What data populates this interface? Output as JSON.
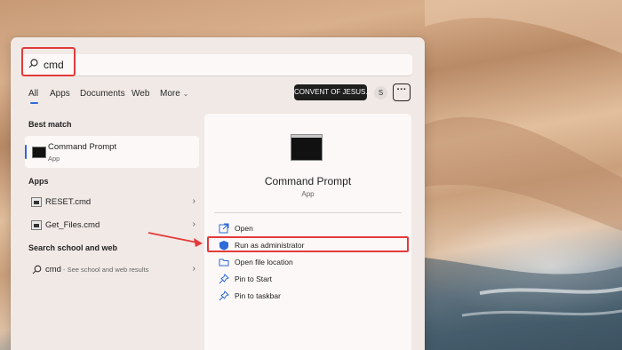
{
  "search": {
    "query": "cmd"
  },
  "tabs": [
    "All",
    "Apps",
    "Documents",
    "Web",
    "More"
  ],
  "header": {
    "org_badge": "CONVENT OF JESUS...",
    "avatar_letter": "S",
    "more_label": "···"
  },
  "best_match": {
    "heading": "Best match",
    "title": "Command Prompt",
    "subtitle": "App"
  },
  "apps": {
    "heading": "Apps",
    "items": [
      {
        "label": "RESET.cmd"
      },
      {
        "label": "Get_Files.cmd"
      }
    ]
  },
  "web": {
    "heading": "Search school and web",
    "query": "cmd",
    "hint": " - See school and web results"
  },
  "detail": {
    "title": "Command Prompt",
    "subtitle": "App",
    "actions": [
      {
        "label": "Open",
        "icon": "open-icon"
      },
      {
        "label": "Run as administrator",
        "icon": "shield-icon"
      },
      {
        "label": "Open file location",
        "icon": "folder-icon"
      },
      {
        "label": "Pin to Start",
        "icon": "pin-icon"
      },
      {
        "label": "Pin to taskbar",
        "icon": "pin-icon"
      }
    ]
  },
  "colors": {
    "accent": "#2e6ad8",
    "highlight": "#e23b3b"
  }
}
